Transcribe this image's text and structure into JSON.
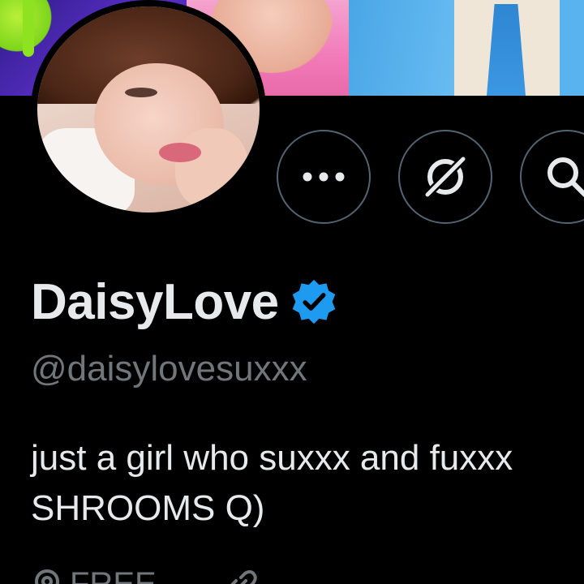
{
  "profile": {
    "display_name": "DaisyLove",
    "handle": "@daisylovesuxxx",
    "verified": true,
    "bio_lines": [
      "just a girl who suxxx and fuxxx",
      "SHROOMS Q)"
    ]
  },
  "actions": {
    "more_icon": "more-dots-icon",
    "grok_icon": "grok-icon",
    "search_icon": "search-icon"
  },
  "meta": {
    "location_icon": "location-pin-icon",
    "location_text": "FREE",
    "link_icon": "link-icon"
  },
  "colors": {
    "background": "#000000",
    "primary_text": "#e7e9ea",
    "secondary_text": "#71767b",
    "verified_blue": "#1d9bf0",
    "button_border": "#536471"
  }
}
